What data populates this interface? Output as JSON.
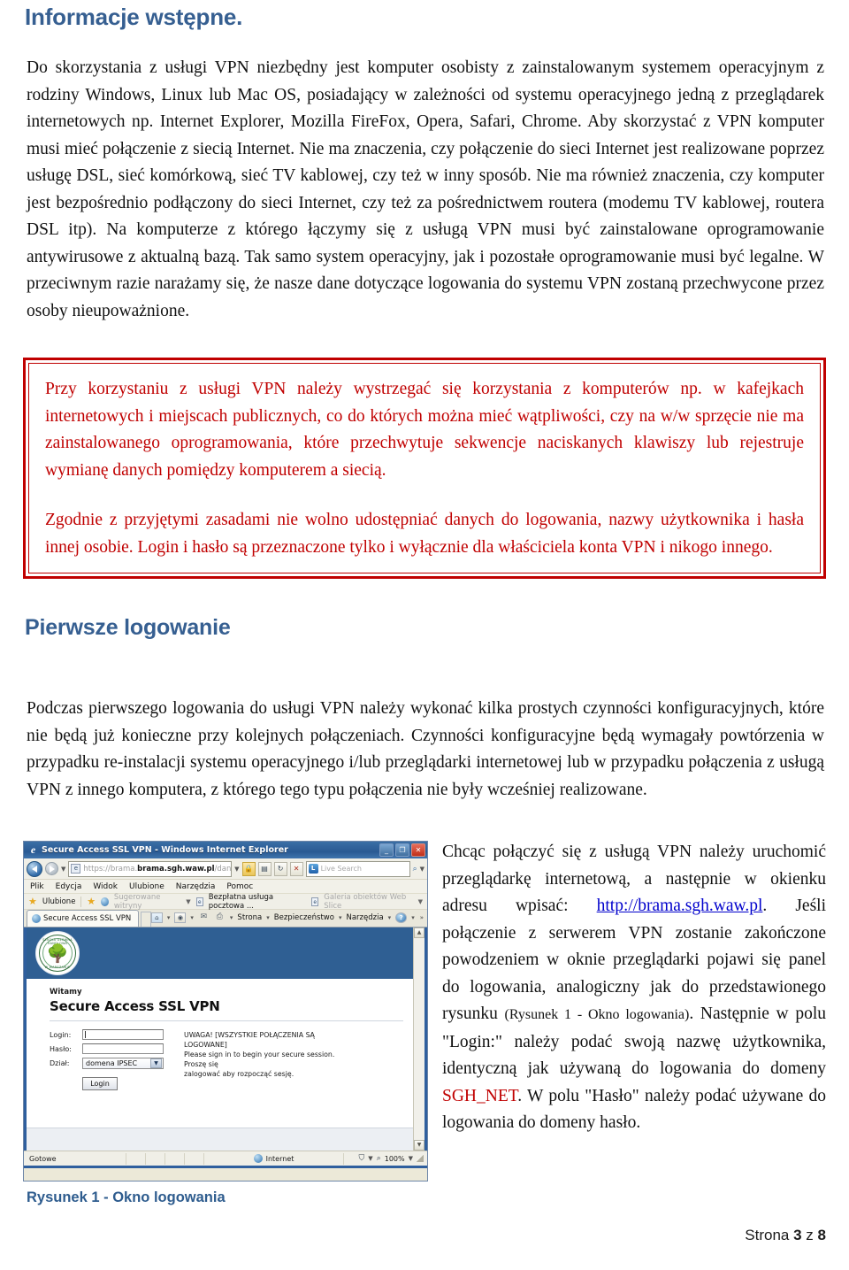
{
  "document": {
    "headings": {
      "intro": "Informacje wstępne.",
      "first_login": "Pierwsze logowanie"
    },
    "paragraphs": {
      "intro": "Do skorzystania z usługi VPN niezbędny jest komputer osobisty z zainstalowanym systemem operacyjnym z rodziny Windows, Linux lub Mac OS, posiadający w zależności od systemu operacyjnego jedną z przeglądarek  internetowych np. Internet Explorer, Mozilla FireFox, Opera, Safari, Chrome. Aby skorzystać z VPN komputer musi mieć połączenie z siecią Internet. Nie ma znaczenia, czy połączenie do sieci Internet jest realizowane poprzez usługę DSL, sieć komórkową, sieć TV kablowej, czy też w inny sposób. Nie ma również znaczenia, czy komputer jest bezpośrednio podłączony do sieci Internet, czy też za pośrednictwem routera (modemu TV kablowej, routera DSL itp).  Na komputerze z którego łączymy się z usługą VPN musi być zainstalowane oprogramowanie antywirusowe z aktualną bazą. Tak samo system operacyjny, jak i pozostałe oprogramowanie musi być legalne. W przeciwnym razie narażamy się, że nasze dane dotyczące logowania do systemu VPN zostaną przechwycone przez osoby nieupoważnione.",
      "first_login": "Podczas pierwszego logowania do usługi VPN należy wykonać kilka prostych czynności konfiguracyjnych, które nie będą już konieczne przy kolejnych połączeniach. Czynności konfiguracyjne będą wymagały powtórzenia w przypadku re-instalacji systemu operacyjnego i/lub przeglądarki internetowej lub w przypadku połączenia z usługą VPN z innego komputera, z którego tego typu połączenia nie były wcześniej realizowane."
    },
    "warning_box": {
      "border_color": "#C00000",
      "text_color": "#C00000",
      "paragraph_1": "Przy korzystaniu z usługi VPN należy wystrzegać się korzystania z komputerów np. w kafejkach internetowych i miejscach publicznych, co do których można mieć wątpliwości, czy na w/w sprzęcie nie ma zainstalowanego oprogramowania, które przechwytuje sekwencje naciskanych klawiszy lub rejestruje wymianę danych pomiędzy komputerem a siecią.",
      "paragraph_2": "Zgodnie z przyjętymi zasadami nie wolno udostępniać danych do logowania, nazwy użytkownika i hasła innej osobie. Login i hasło są przeznaczone tylko i wyłącznie dla właściciela konta VPN i nikogo innego."
    },
    "right_column": {
      "part_1": "Chcąc połączyć się z usługą VPN należy uruchomić przeglądarkę internetową, a następnie w okienku adresu wpisać: ",
      "link_text": "http://brama.sgh.waw.pl",
      "link_color": "#0000CC",
      "part_2": ". Jeśli połączenie z serwerem VPN zostanie zakończone powodzeniem w oknie przeglądarki pojawi się panel do logowania, analogiczny jak do przedstawionego rysunku ",
      "figure_ref": "(Rysunek 1 - Okno logowania)",
      "part_3": ". Następnie w polu \"Login:\" należy podać swoją nazwę użytkownika, identyczną jak używaną do logowania do domeny ",
      "domain_highlight": "SGH_NET",
      "domain_highlight_color": "#C00000",
      "part_4": ". W polu \"Hasło\" należy podać używane do logowania do domeny hasło."
    },
    "figure_caption": "Rysunek 1 - Okno logowania",
    "footer": {
      "prefix": "Strona ",
      "current_page": "3",
      "middle": " z ",
      "total_pages": "8"
    },
    "heading_color": "#365F91"
  },
  "figure_browser": {
    "titlebar": {
      "favicon": "ie-logo-icon",
      "title": "Secure Access SSL VPN - Windows Internet Explorer",
      "minimize_label": "_",
      "maximize_label": "❐",
      "close_label": "✕"
    },
    "address_bar": {
      "back_icon": "back-arrow-icon",
      "forward_icon": "forward-arrow-icon",
      "history_caret": "▼",
      "page_icon": "page-icon",
      "url_visible": "https://",
      "url_bold": "brama.sgh.waw.pl",
      "url_dim_1": "brama.",
      "url_dim_2": "/dana-na/au",
      "dropdown_caret": "▼",
      "lock_icon": "padlock-icon",
      "compat_icon": "compatibility-view-icon",
      "refresh_icon": "refresh-icon",
      "stop_icon": "✕",
      "search_engine_icon": "live-search-icon",
      "search_placeholder": "Live Search",
      "search_go_icon": "magnifier-icon",
      "search_caret": "▼"
    },
    "menu_items": [
      "Plik",
      "Edycja",
      "Widok",
      "Ulubione",
      "Narzędzia",
      "Pomoc"
    ],
    "favorites_bar": {
      "star_icon": "star-icon",
      "favorites_label": "Ulubione",
      "add_icon": "add-to-favorites-icon",
      "suggested_sites": "Sugerowane witryny",
      "item_1": "Bezpłatna usługa pocztowa ...",
      "item_2": "Galeria obiektów Web Slice",
      "caret": "▼"
    },
    "tab_bar": {
      "tab_label": "Secure Access SSL VPN",
      "tab_icon": "ie-tab-icon",
      "home_icon": "home-icon",
      "feeds_icon": "feeds-icon",
      "mail_icon": "mail-icon",
      "print_icon": "printer-icon",
      "page_menu": "Strona",
      "safety_menu": "Bezpieczeństwo",
      "tools_menu": "Narzędzia",
      "help_icon": "help-icon",
      "overflow_icon": "»"
    },
    "page_content": {
      "banner_color": "#2F5F93",
      "logo": "sgh-seal-logo",
      "logo_arc_top": "SZKOŁA GŁÓWNA HANDLOWA",
      "logo_arc_bottom": "W WARSZAWIE",
      "welcome": "Witamy",
      "title": "Secure Access SSL VPN",
      "form": {
        "login_label": "Login:",
        "login_value": "",
        "password_label": "Hasło:",
        "password_value": "",
        "realm_label": "Dział:",
        "realm_value": "domena IPSEC",
        "realm_caret": "▼",
        "submit_label": "Login"
      },
      "notice_line_1": "UWAGA! [WSZYSTKIE POŁĄCZENIA SĄ LOGOWANE]",
      "notice_line_2": "Please sign in to begin your secure session. Proszę się",
      "notice_line_3": "zalogować aby rozpocząć sesję."
    },
    "scrollbar": {
      "up_arrow": "▲",
      "down_arrow": "▼"
    },
    "status_bar": {
      "state": "Gotowe",
      "zone_icon": "internet-zone-icon",
      "zone_label": "Internet",
      "protected_mode_icon": "protected-mode-icon",
      "protected_caret": "▼",
      "zoom_icon": "magnifier-icon",
      "zoom_level": "100%",
      "zoom_caret": "▼"
    }
  }
}
